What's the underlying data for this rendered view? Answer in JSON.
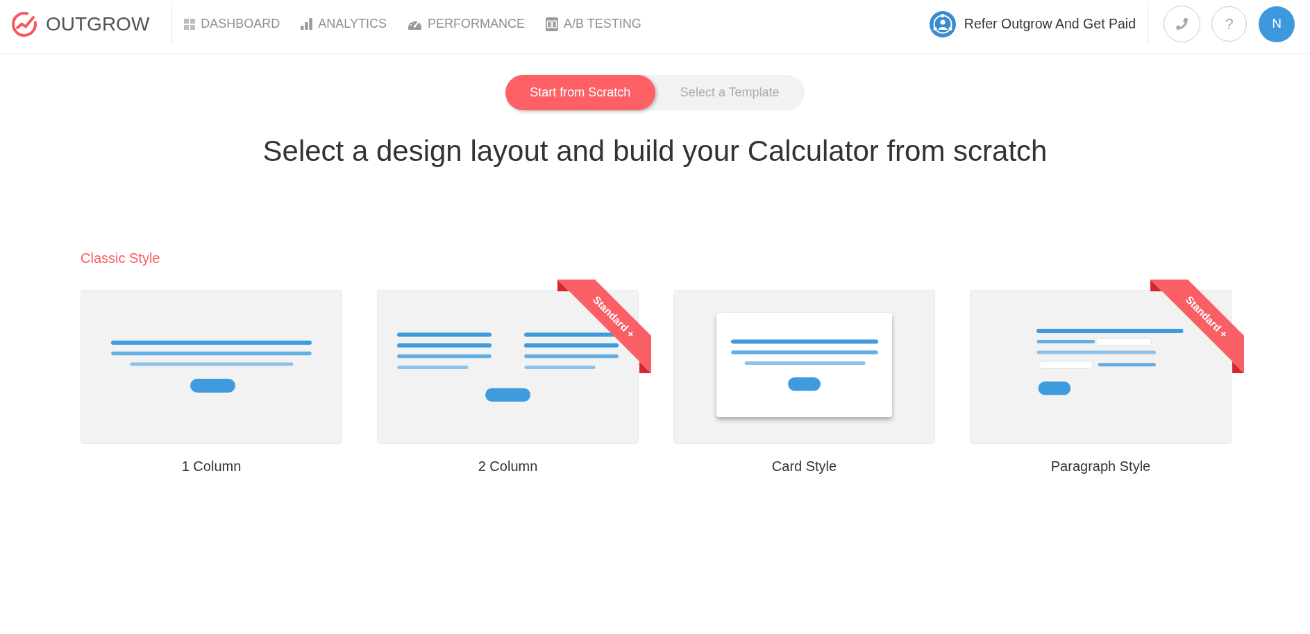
{
  "header": {
    "logo": "OUTGROW",
    "nav": [
      {
        "label": "DASHBOARD",
        "selected": false
      },
      {
        "label": "ANALYTICS",
        "selected": false
      },
      {
        "label": "PERFORMANCE",
        "selected": false
      },
      {
        "label": "A/B TESTING",
        "selected": false
      }
    ],
    "refer_link": "Refer Outgrow And Get Paid",
    "help_button": "?",
    "avatar": "N"
  },
  "mode_toggle": [
    {
      "label": "Start from Scratch",
      "selected": true
    },
    {
      "label": "Select a Template",
      "selected": false
    }
  ],
  "title": "Select a design layout and build your Calculator from scratch",
  "section": {
    "heading": "Classic Style",
    "layouts": [
      {
        "kind": "one_column",
        "label": "1 Column"
      },
      {
        "kind": "two_column",
        "label": "2 Column",
        "ribbon": "Standard +"
      },
      {
        "kind": "card",
        "label": "Card Style"
      },
      {
        "kind": "paragraph",
        "label": "Paragraph Style",
        "ribbon": "Standard +"
      }
    ]
  }
}
